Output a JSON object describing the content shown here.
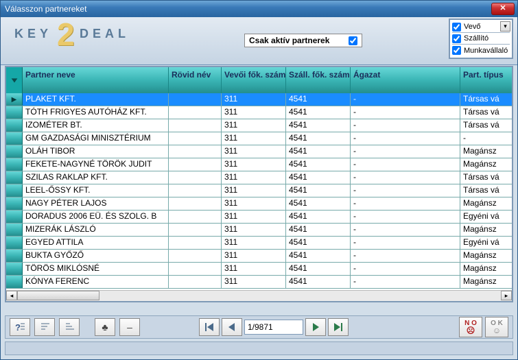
{
  "window": {
    "title": "Válasszon partnereket"
  },
  "topbar": {
    "active_label": "Csak aktív partnerek",
    "active_checked": true,
    "filters": {
      "vevo": {
        "label": "Vevő",
        "checked": true
      },
      "szallito": {
        "label": "Szállító",
        "checked": true
      },
      "munka": {
        "label": "Munkavállaló",
        "checked": true
      }
    }
  },
  "columns": {
    "name": "Partner neve",
    "short": "Rövid név",
    "vev": "Vevői fők. szám",
    "szall": "Száll. fők. szám",
    "agaz": "Ágazat",
    "tip": "Part. típus"
  },
  "rows": [
    {
      "name": "PLAKET KFT.",
      "short": "",
      "vev": "311",
      "szall": "4541",
      "agaz": "-",
      "tip": "Társas vá",
      "selected": true
    },
    {
      "name": "TÓTH FRIGYES AUTÓHÁZ KFT.",
      "short": "",
      "vev": "311",
      "szall": "4541",
      "agaz": "-",
      "tip": "Társas vá"
    },
    {
      "name": "IZOMÉTER BT.",
      "short": "",
      "vev": "311",
      "szall": "4541",
      "agaz": "-",
      "tip": "Társas vá"
    },
    {
      "name": "GM GAZDASÁGI MINISZTÉRIUM",
      "short": "",
      "vev": "311",
      "szall": "4541",
      "agaz": "-",
      "tip": "-"
    },
    {
      "name": "OLÁH TIBOR",
      "short": "",
      "vev": "311",
      "szall": "4541",
      "agaz": "-",
      "tip": "Magánsz"
    },
    {
      "name": "FEKETE-NAGYNÉ TÖRÖK JUDIT",
      "short": "",
      "vev": "311",
      "szall": "4541",
      "agaz": "-",
      "tip": "Magánsz"
    },
    {
      "name": "SZILAS RAKLAP KFT.",
      "short": "",
      "vev": "311",
      "szall": "4541",
      "agaz": "-",
      "tip": "Társas vá"
    },
    {
      "name": "LEEL-ŐSSY KFT.",
      "short": "",
      "vev": "311",
      "szall": "4541",
      "agaz": "-",
      "tip": "Társas vá"
    },
    {
      "name": "NAGY PÉTER LAJOS",
      "short": "",
      "vev": "311",
      "szall": "4541",
      "agaz": "-",
      "tip": "Magánsz"
    },
    {
      "name": "DORADUS 2006 EÜ. ÉS SZOLG. B",
      "short": "",
      "vev": "311",
      "szall": "4541",
      "agaz": "-",
      "tip": "Egyéni vá"
    },
    {
      "name": "MIZERÁK LÁSZLÓ",
      "short": "",
      "vev": "311",
      "szall": "4541",
      "agaz": "-",
      "tip": "Magánsz"
    },
    {
      "name": "EGYED ATTILA",
      "short": "",
      "vev": "311",
      "szall": "4541",
      "agaz": "-",
      "tip": "Egyéni vá"
    },
    {
      "name": "BUKTA GYŐZŐ",
      "short": "",
      "vev": "311",
      "szall": "4541",
      "agaz": "-",
      "tip": "Magánsz"
    },
    {
      "name": "TÖRÖS MIKLÓSNÉ",
      "short": "",
      "vev": "311",
      "szall": "4541",
      "agaz": "-",
      "tip": "Magánsz"
    },
    {
      "name": "KÓNYA FERENC",
      "short": "",
      "vev": "311",
      "szall": "4541",
      "agaz": "-",
      "tip": "Magánsz"
    }
  ],
  "pager": {
    "position": "1/9871"
  },
  "buttons": {
    "no": "N O",
    "ok": "O K"
  }
}
